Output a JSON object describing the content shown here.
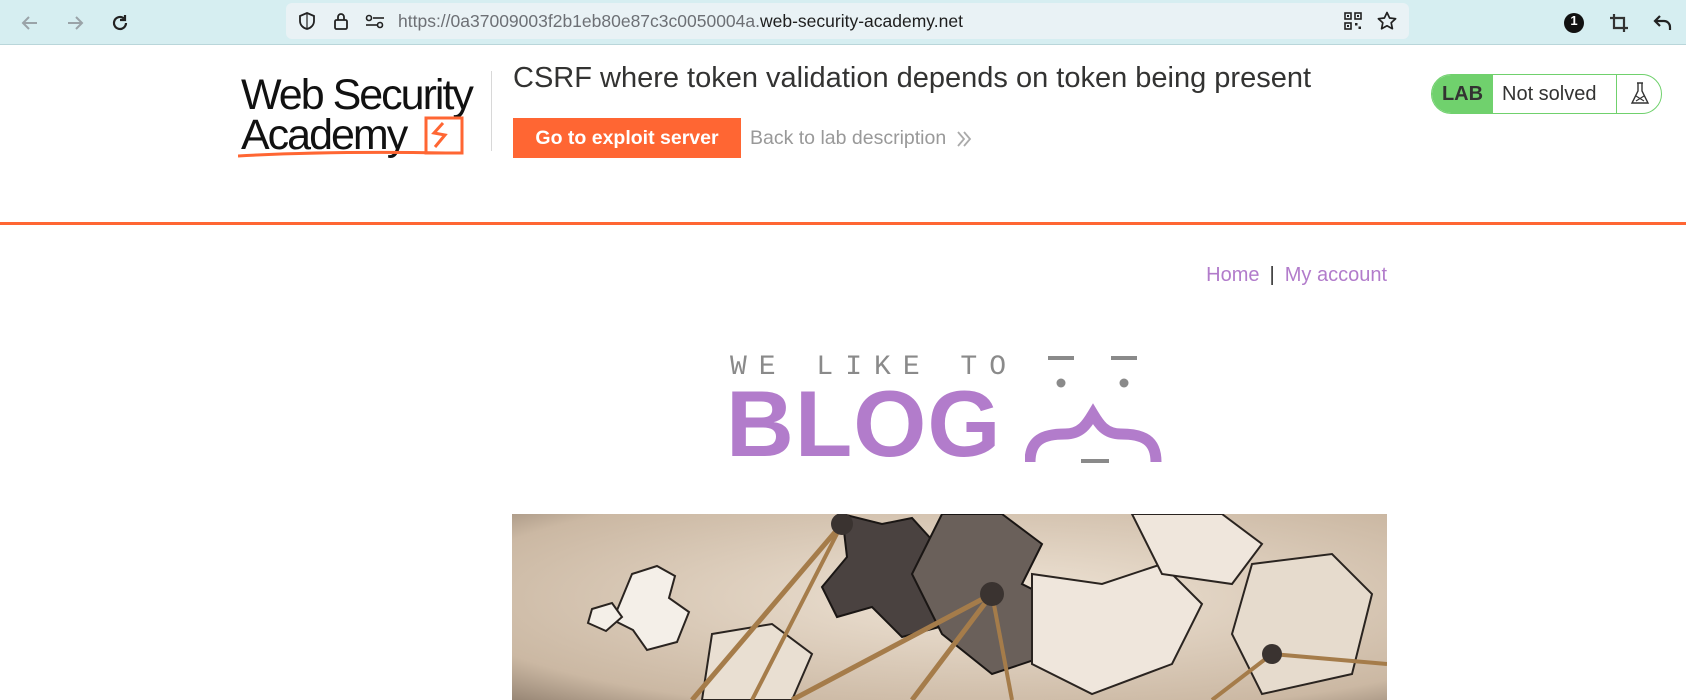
{
  "browser": {
    "url_prefix": "https://0a37009003f2b1eb80e87c3c0050004a.",
    "url_host": "web-security-academy.net",
    "extension_badge": "1"
  },
  "lab": {
    "logo_line1": "Web Security",
    "logo_line2": "Academy",
    "title": "CSRF where token validation depends on token being present",
    "exploit_button": "Go to exploit server",
    "back_link": "Back to lab description",
    "status_tag": "LAB",
    "status_text": "Not solved"
  },
  "site": {
    "nav_home": "Home",
    "nav_separator": "|",
    "nav_account": "My account",
    "banner_top": "WE LIKE TO",
    "banner_main": "BLOG"
  },
  "colors": {
    "accent": "#ff6633",
    "lab_green": "#70d16d",
    "link_purple": "#b27ccb",
    "toolbar_bg": "#d6eef1"
  },
  "icons": [
    "back-arrow-icon",
    "forward-arrow-icon",
    "reload-icon",
    "shield-icon",
    "lock-icon",
    "permissions-icon",
    "qr-code-icon",
    "bookmark-star-icon",
    "extension-badge-icon",
    "crop-icon",
    "undo-icon",
    "flask-icon",
    "chevron-double-right-icon"
  ]
}
